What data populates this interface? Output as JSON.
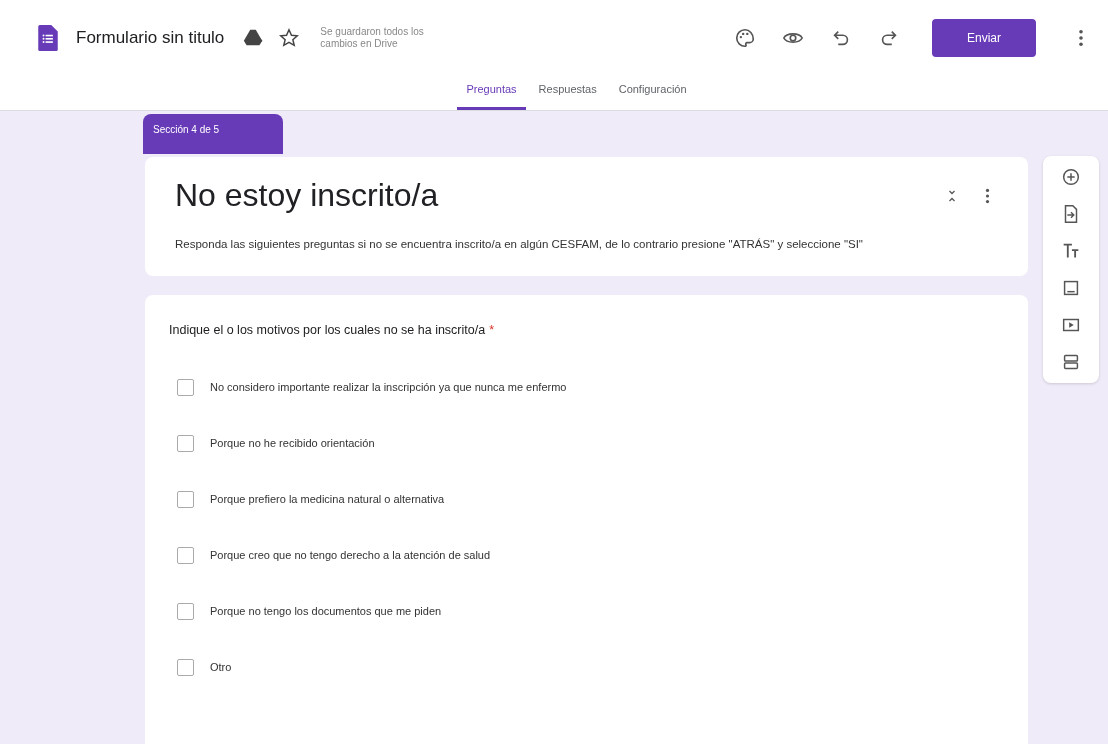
{
  "header": {
    "title": "Formulario sin titulo",
    "save_status": "Se guardaron todos los cambios en Drive",
    "send_button": "Enviar"
  },
  "tabs": [
    {
      "label": "Preguntas",
      "selected": true
    },
    {
      "label": "Respuestas",
      "selected": false
    },
    {
      "label": "Configuración",
      "selected": false
    }
  ],
  "section": {
    "label": "Sección 4 de 5",
    "title": "No estoy inscrito/a",
    "description": "Responda las siguientes preguntas si no se encuentra inscrito/a en algún CESFAM, de lo contrario presione \"ATRÁS\" y seleccione \"SI\""
  },
  "question": {
    "text": "Indique el o los motivos por los cuales no se ha inscrito/a",
    "required_mark": "*",
    "options": [
      {
        "label": "No considero importante realizar la inscripción ya que nunca me enfermo",
        "checked": false
      },
      {
        "label": "Porque no he recibido orientación",
        "checked": false
      },
      {
        "label": "Porque prefiero la medicina natural o alternativa",
        "checked": false
      },
      {
        "label": "Porque creo que no tengo derecho a la atención de salud",
        "checked": false
      },
      {
        "label": "Porque no tengo los documentos que me piden",
        "checked": false
      },
      {
        "label": "Otro",
        "checked": false
      }
    ]
  }
}
